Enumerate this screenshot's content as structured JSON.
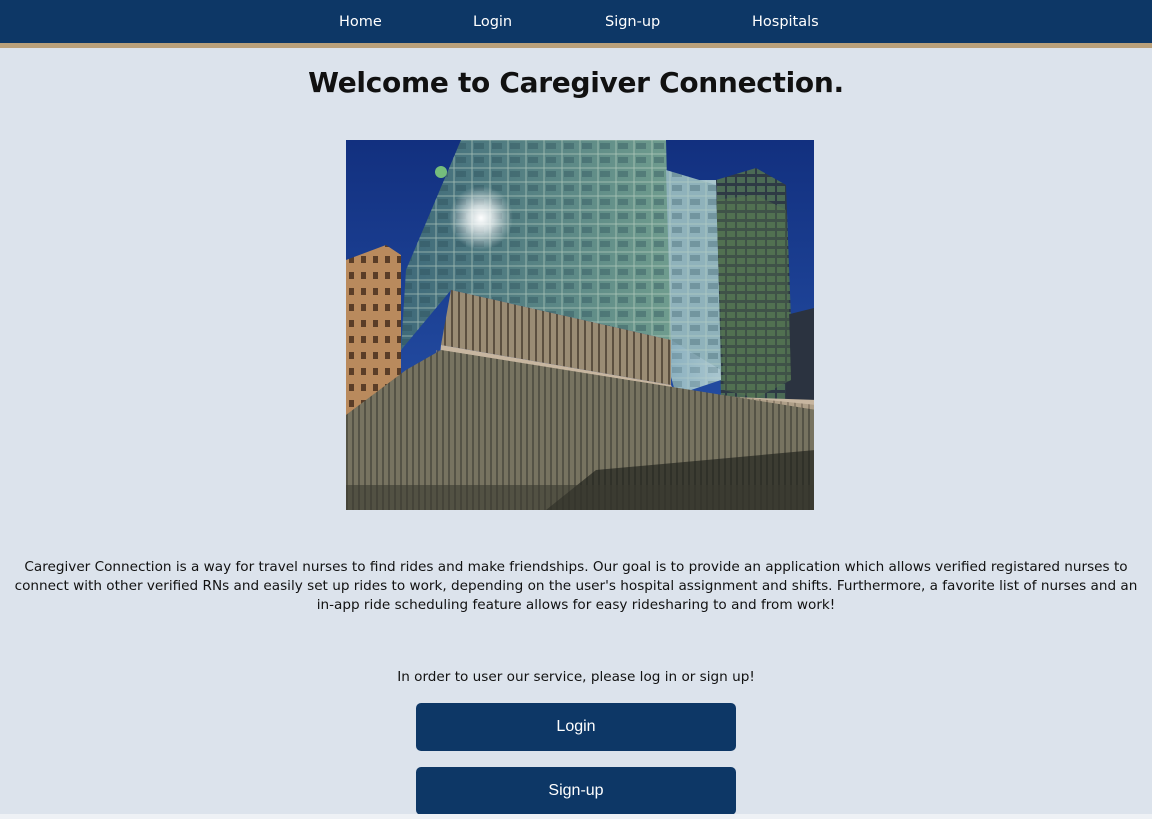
{
  "nav": {
    "home": "Home",
    "login": "Login",
    "signup": "Sign-up",
    "hospitals": "Hospitals"
  },
  "main": {
    "title": "Welcome to Caregiver Connection.",
    "description": "Caregiver Connection is a way for travel nurses to find rides and make friendships. Our goal is to provide an application which allows verified registared nurses to connect with other verified RNs and easily set up rides to work, depending on the user's hospital assignment and shifts. Furthermore, a favorite list of nurses and an in-app ride scheduling feature allows for easy ridesharing to and from work!",
    "prompt": "In order to user our service, please log in or sign up!",
    "login_button": "Login",
    "signup_button": "Sign-up"
  },
  "colors": {
    "nav_background": "#0d3766",
    "nav_accent": "#b9a07a",
    "page_background": "#dce3ec",
    "button_background": "#0d3766"
  }
}
